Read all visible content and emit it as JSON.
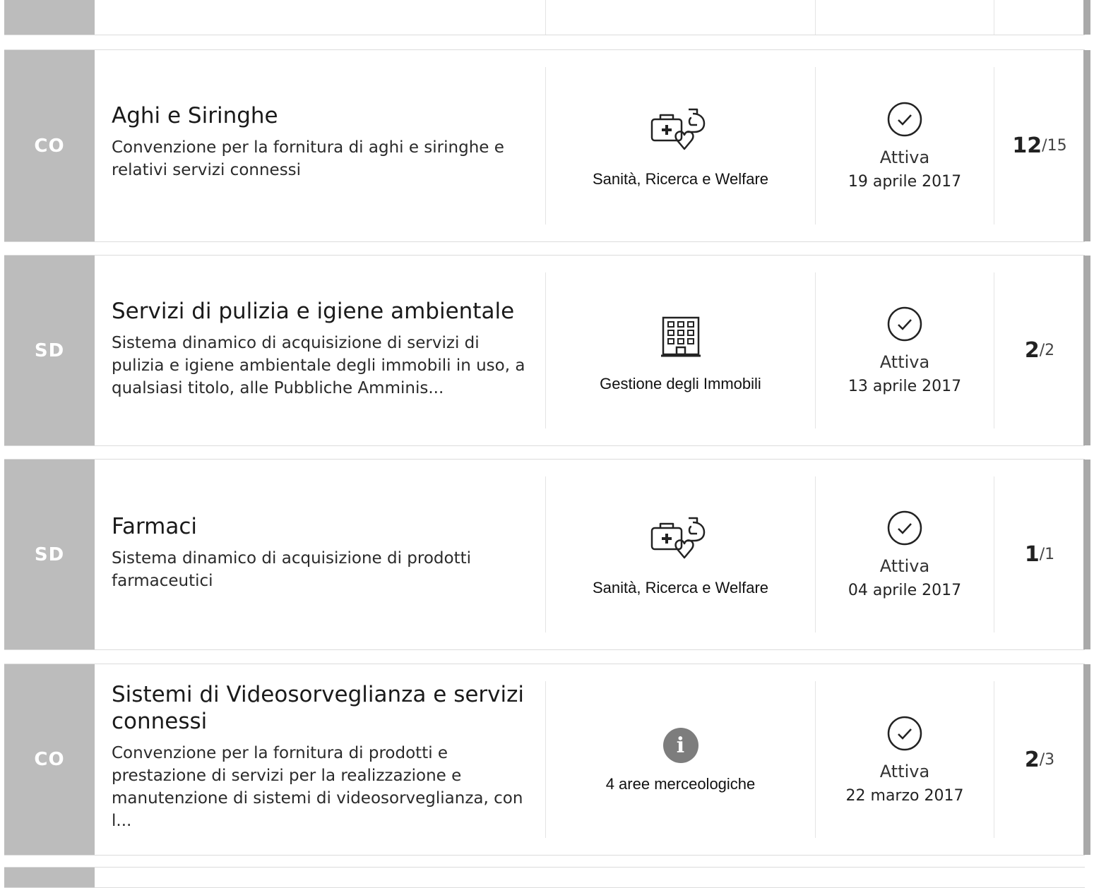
{
  "tenders": [
    {
      "type_code": "CO",
      "title": "Aghi e Siringhe",
      "description": "Convenzione per la fornitura di aghi e siringhe e relativi servizi connessi",
      "area": "Sanità, Ricerca e Welfare",
      "area_icon": "health-research-icon",
      "status": "Attiva",
      "date": "19 aprile 2017",
      "count_current": "12",
      "count_total": "15"
    },
    {
      "type_code": "SD",
      "title": "Servizi di pulizia e igiene ambientale",
      "description": "Sistema dinamico di acquisizione di servizi di pulizia e igiene ambientale degli immobili in uso, a qualsiasi titolo, alle Pubbliche Amminis...",
      "area": "Gestione degli Immobili",
      "area_icon": "building-icon",
      "status": "Attiva",
      "date": "13 aprile 2017",
      "count_current": "2",
      "count_total": "2"
    },
    {
      "type_code": "SD",
      "title": "Farmaci",
      "description": "Sistema dinamico di acquisizione di prodotti farmaceutici",
      "area": "Sanità, Ricerca e Welfare",
      "area_icon": "health-research-icon",
      "status": "Attiva",
      "date": "04 aprile 2017",
      "count_current": "1",
      "count_total": "1"
    },
    {
      "type_code": "CO",
      "title": "Sistemi di Videosorveglianza e servizi connessi",
      "description": "Convenzione per la fornitura di prodotti e prestazione di servizi per la realizzazione e manutenzione di sistemi di videosorveglianza, con l...",
      "area": "4 aree merceologiche",
      "area_icon": "info-icon",
      "status": "Attiva",
      "date": "22 marzo 2017",
      "count_current": "2",
      "count_total": "3"
    }
  ],
  "count_separator": "/",
  "info_glyph": "i",
  "colors": {
    "badge_bg": "#bcbcbc",
    "badge_text": "#ffffff",
    "divider": "#e4e4e4",
    "info_icon_bg": "#7d7d7d"
  }
}
